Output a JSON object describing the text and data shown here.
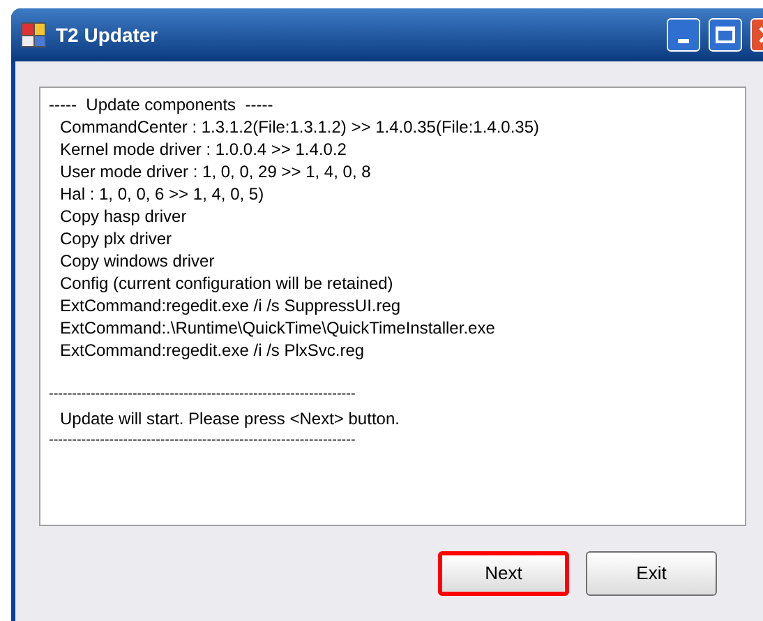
{
  "window": {
    "title": "T2 Updater"
  },
  "log": [
    {
      "kind": "header",
      "text": "-----  Update components  -----"
    },
    {
      "kind": "item",
      "text": "CommandCenter : 1.3.1.2(File:1.3.1.2) >> 1.4.0.35(File:1.4.0.35)"
    },
    {
      "kind": "item",
      "text": "Kernel mode driver : 1.0.0.4 >> 1.4.0.2"
    },
    {
      "kind": "item",
      "text": "User mode driver : 1, 0, 0, 29 >> 1, 4, 0, 8"
    },
    {
      "kind": "item",
      "text": "Hal : 1, 0, 0, 6 >> 1, 4, 0, 5)"
    },
    {
      "kind": "item",
      "text": "Copy hasp driver"
    },
    {
      "kind": "item",
      "text": "Copy plx driver"
    },
    {
      "kind": "item",
      "text": "Copy windows driver"
    },
    {
      "kind": "item",
      "text": "Config (current configuration will be retained)"
    },
    {
      "kind": "item",
      "text": "ExtCommand:regedit.exe /i /s SuppressUI.reg"
    },
    {
      "kind": "item",
      "text": "ExtCommand:.\\Runtime\\QuickTime\\QuickTimeInstaller.exe"
    },
    {
      "kind": "item",
      "text": "ExtCommand:regedit.exe /i /s PlxSvc.reg"
    },
    {
      "kind": "rule",
      "text": "------------------------------------------------------------------"
    },
    {
      "kind": "item",
      "text": "Update will start. Please press <Next> button."
    },
    {
      "kind": "rule",
      "text": "------------------------------------------------------------------"
    }
  ],
  "buttons": [
    {
      "label": "Next",
      "highlighted": true
    },
    {
      "label": "Exit",
      "highlighted": false
    }
  ]
}
